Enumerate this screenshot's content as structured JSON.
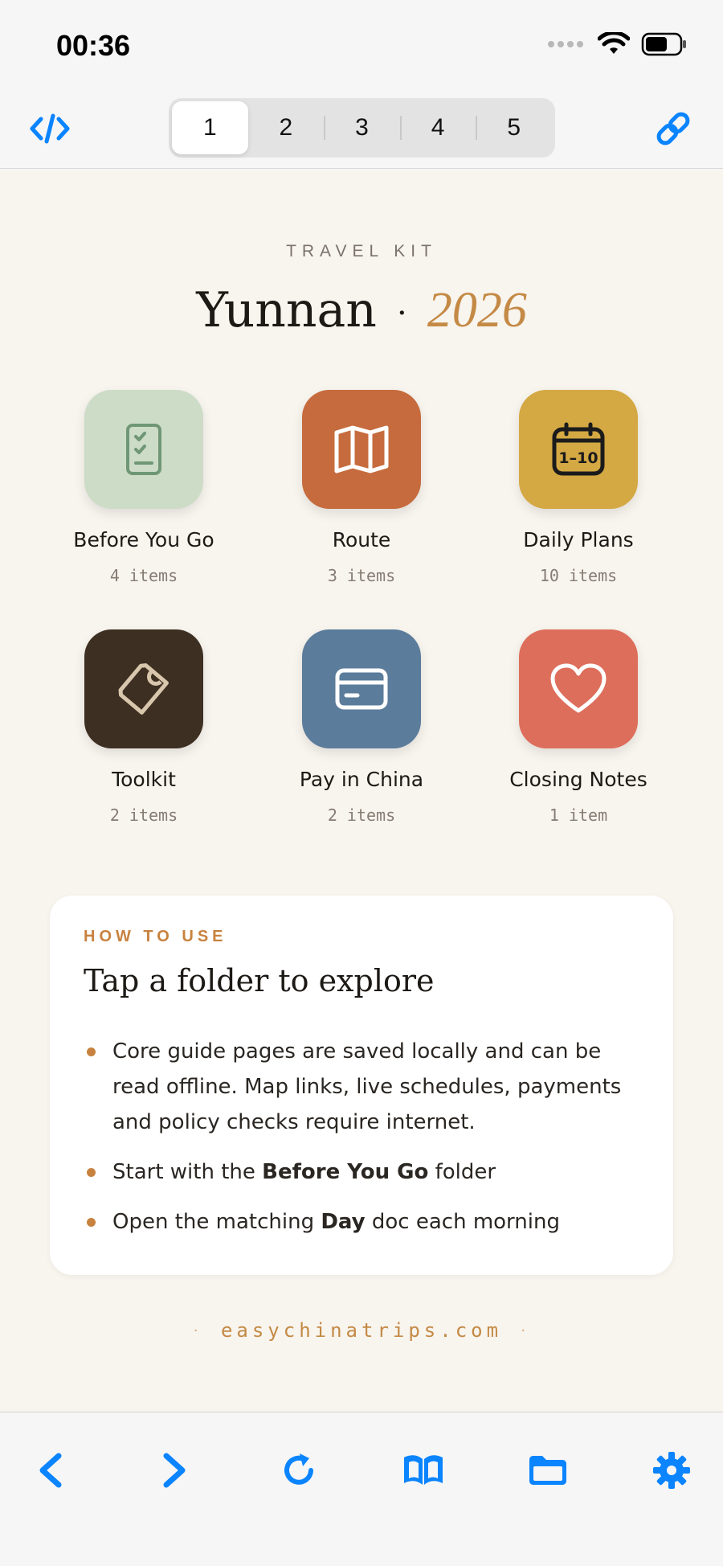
{
  "status_bar": {
    "time": "00:36"
  },
  "toolbar": {
    "segments": [
      "1",
      "2",
      "3",
      "4",
      "5"
    ],
    "active_segment": 0
  },
  "header": {
    "kicker": "TRAVEL KIT",
    "title": "Yunnan",
    "separator": "·",
    "year": "2026"
  },
  "folders": [
    {
      "label": "Before You Go",
      "count": "4 items",
      "icon": "checklist-icon",
      "color": "#cddcc7"
    },
    {
      "label": "Route",
      "count": "3 items",
      "icon": "map-icon",
      "color": "#c66b3d"
    },
    {
      "label": "Daily Plans",
      "count": "10 items",
      "icon": "calendar-icon",
      "color": "#d4a843",
      "icon_text": "1–10"
    },
    {
      "label": "Toolkit",
      "count": "2 items",
      "icon": "tag-icon",
      "color": "#3d2f22"
    },
    {
      "label": "Pay in China",
      "count": "2 items",
      "icon": "card-icon",
      "color": "#5b7c9b"
    },
    {
      "label": "Closing Notes",
      "count": "1 item",
      "icon": "heart-icon",
      "color": "#dd6e5b"
    }
  ],
  "how_to": {
    "kicker": "HOW TO USE",
    "title": "Tap a folder to explore",
    "item1": "Core guide pages are saved locally and can be read offline. Map links, live schedules, payments and policy checks require internet.",
    "item2_pre": "Start with the ",
    "item2_bold": "Before You Go",
    "item2_post": " folder",
    "item3_pre": "Open the matching ",
    "item3_bold": "Day",
    "item3_post": " doc each morning"
  },
  "footer": {
    "site": "easychinatrips.com",
    "dot": "·"
  },
  "colors": {
    "accent": "#c8823f",
    "ios_blue": "#0a84ff",
    "background": "#f8f4ee"
  }
}
